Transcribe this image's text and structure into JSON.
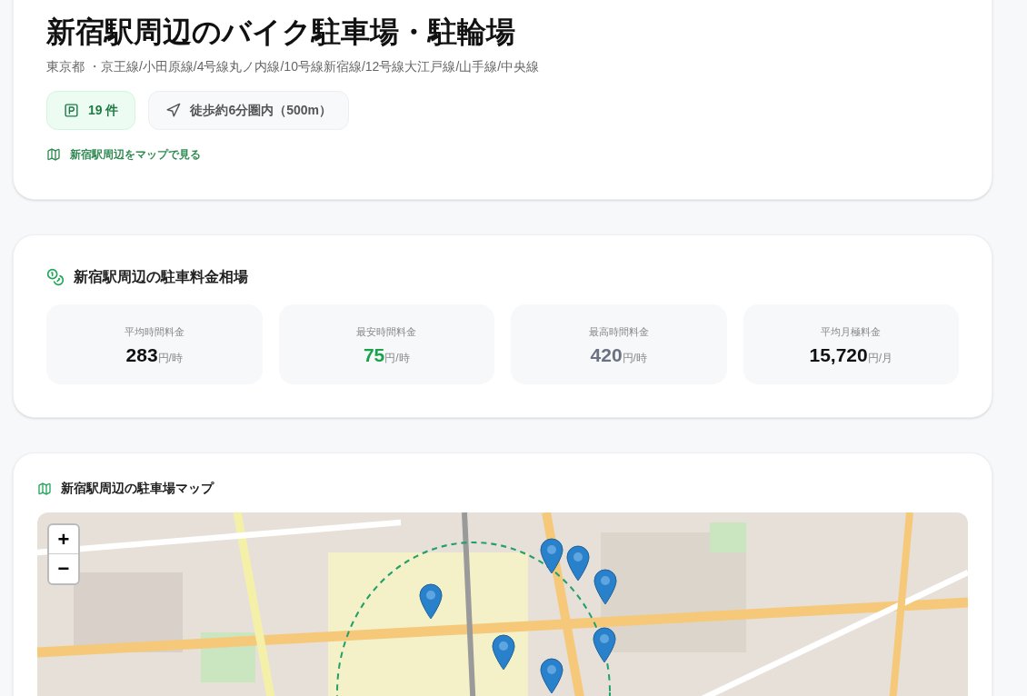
{
  "header": {
    "title": "新宿駅周辺のバイク駐車場・駐輪場",
    "lines": "東京都 ・京王線/小田原線/4号線丸ノ内線/10号線新宿線/12号線大江戸線/山手線/中央線",
    "count_badge": "19 件",
    "walk_badge": "徒歩約6分圏内（500m）",
    "map_link": "新宿駅周辺をマップで見る"
  },
  "prices": {
    "title": "新宿駅周辺の駐車料金相場",
    "items": [
      {
        "label": "平均時間料金",
        "value": "283",
        "unit": "円/時",
        "color": "#111111"
      },
      {
        "label": "最安時間料金",
        "value": "75",
        "unit": "円/時",
        "color": "#16a34a"
      },
      {
        "label": "最高時間料金",
        "value": "420",
        "unit": "円/時",
        "color": "#6b7280"
      },
      {
        "label": "平均月極料金",
        "value": "15,720",
        "unit": "円/月",
        "color": "#111111"
      }
    ]
  },
  "map": {
    "title": "新宿駅周辺の駐車場マップ",
    "zoom_in": "+",
    "zoom_out": "−"
  }
}
